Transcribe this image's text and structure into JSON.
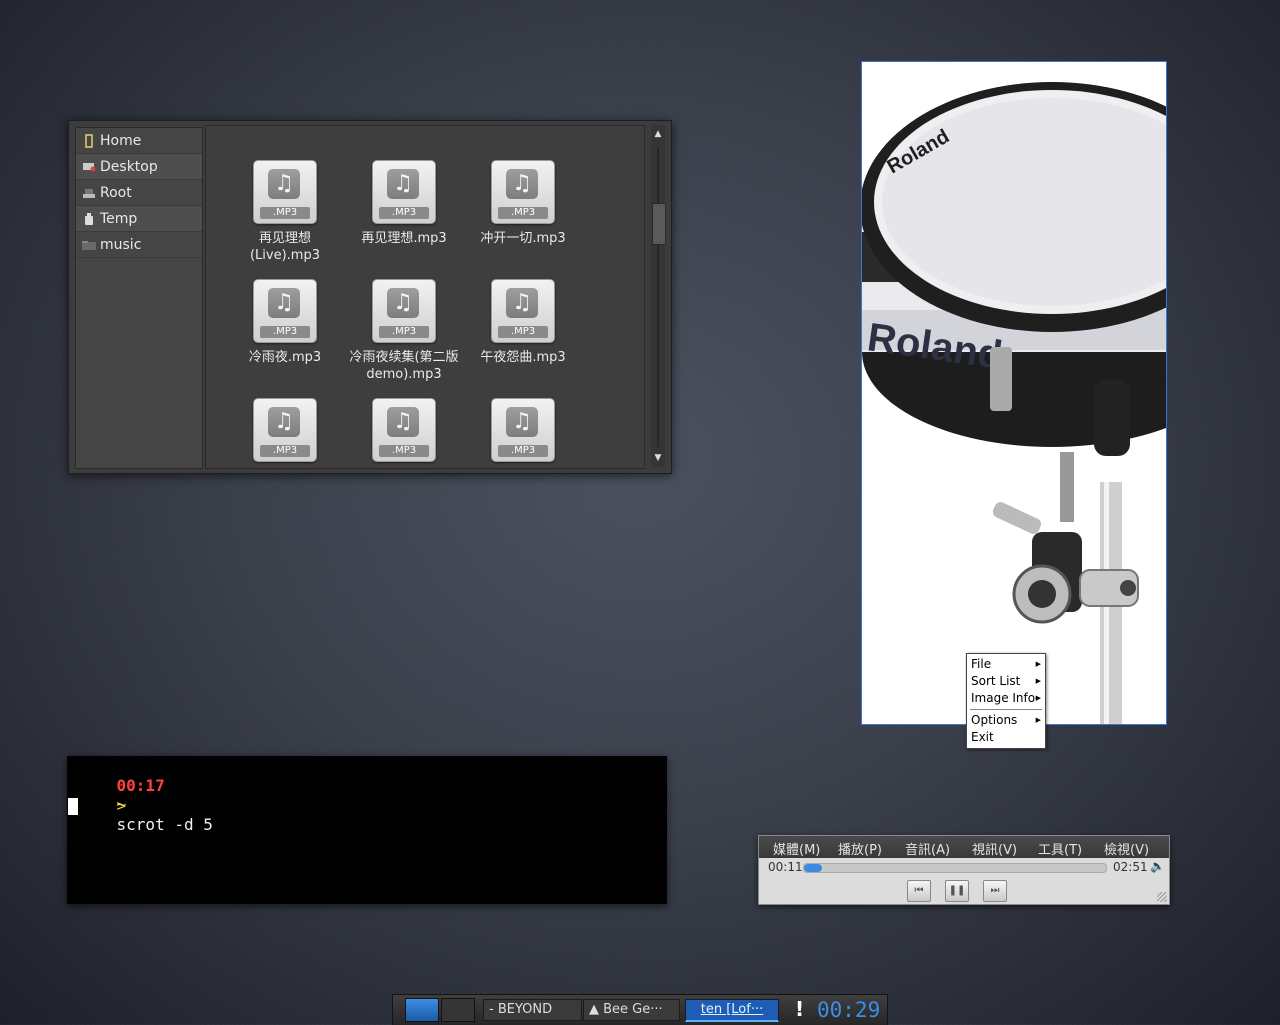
{
  "file_manager": {
    "places": [
      {
        "label": "Home",
        "icon": "home-icon"
      },
      {
        "label": "Desktop",
        "icon": "desktop-icon"
      },
      {
        "label": "Root",
        "icon": "drive-icon"
      },
      {
        "label": "Temp",
        "icon": "trash-icon"
      },
      {
        "label": "music",
        "icon": "folder-icon"
      }
    ],
    "file_badge": ".MP3",
    "files": [
      {
        "name": "再见理想(Live).mp3"
      },
      {
        "name": "再见理想.mp3"
      },
      {
        "name": "冲开一切.mp3"
      },
      {
        "name": "冷雨夜.mp3"
      },
      {
        "name": "冷雨夜续集(第二版demo).mp3"
      },
      {
        "name": "午夜怨曲.mp3"
      },
      {
        "name": ""
      },
      {
        "name": ""
      },
      {
        "name": ""
      }
    ],
    "scroll_up": "▲",
    "scroll_down": "▼"
  },
  "image_viewer": {
    "product_brand": "Roland",
    "context_menu": {
      "items": [
        "File",
        "Sort List",
        "Image Info",
        "Options",
        "Exit"
      ]
    }
  },
  "terminal": {
    "time": "00:17",
    "cwd": "~",
    "prompt": ">",
    "command": "scrot -d 5"
  },
  "player": {
    "menu": [
      "媒體(M)",
      "播放(P)",
      "音訊(A)",
      "視訊(V)",
      "工具(T)",
      "檢視(V)"
    ],
    "elapsed": "00:11",
    "total": "02:51",
    "progress": 0.06,
    "volume_icon": "🔈",
    "buttons": {
      "prev": "⏮",
      "pause": "❚❚",
      "next": "⏭"
    }
  },
  "taskbar": {
    "tasks": [
      "- BEYOND",
      "▲ Bee Ge···",
      "ten [Lof···"
    ],
    "alert": "!",
    "clock": "00:29"
  },
  "colors": {
    "accent": "#3a8fe6",
    "terminal_time": "#ff4040",
    "terminal_prompt": "#f0d020",
    "viewer_border": "#3a78d8"
  }
}
